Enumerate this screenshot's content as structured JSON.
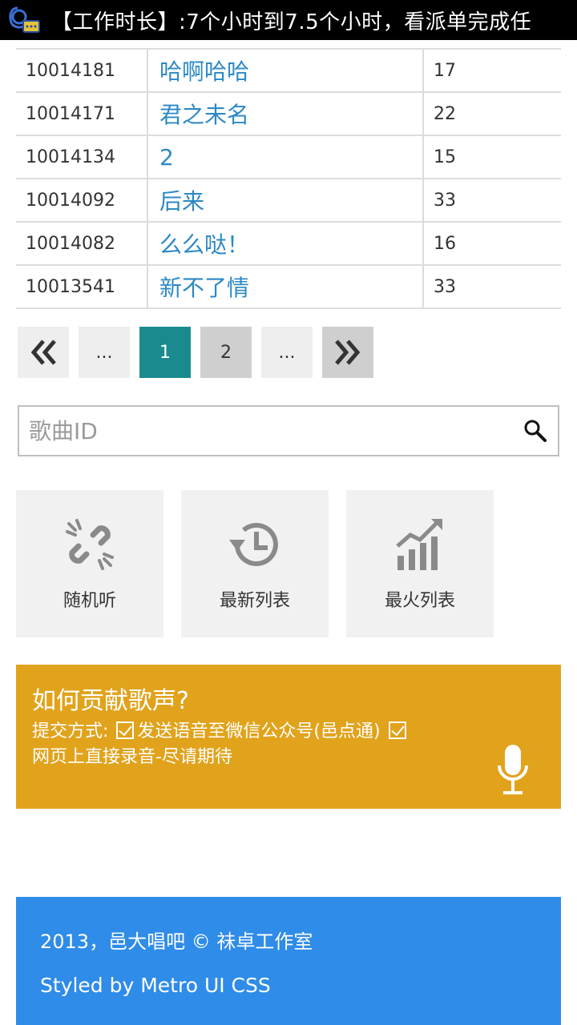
{
  "statusbar": {
    "ticker": "【工作时长】:7个小时到7.5个小时，看派单完成任"
  },
  "table": {
    "rows": [
      {
        "id": "10014181",
        "name": "哈啊哈哈",
        "count": "17"
      },
      {
        "id": "10014171",
        "name": "君之未名",
        "count": "22"
      },
      {
        "id": "10014134",
        "name": "2",
        "count": "15"
      },
      {
        "id": "10014092",
        "name": "后来",
        "count": "33"
      },
      {
        "id": "10014082",
        "name": "么么哒！",
        "count": "16"
      },
      {
        "id": "10013541",
        "name": "新不了情",
        "count": "33"
      }
    ]
  },
  "pager": {
    "prev_ellipsis": "...",
    "page1": "1",
    "page2": "2",
    "next_ellipsis": "..."
  },
  "search": {
    "placeholder": "歌曲ID"
  },
  "tiles": {
    "random": "随机听",
    "latest": "最新列表",
    "hottest": "最火列表"
  },
  "contribute": {
    "title": "如何贡献歌声?",
    "method_label": "提交方式:",
    "option1": "发送语音至微信公众号(邑点通)",
    "option2": "网页上直接录音-尽请期待"
  },
  "footer": {
    "line1": "2013，邑大唱吧  © 祙卓工作室",
    "line2": "Styled by Metro UI CSS"
  },
  "colors": {
    "accent_teal": "#1b8a8f",
    "link_blue": "#2b89c5",
    "panel_orange": "#e1a31c",
    "footer_blue": "#2f8ce8"
  }
}
